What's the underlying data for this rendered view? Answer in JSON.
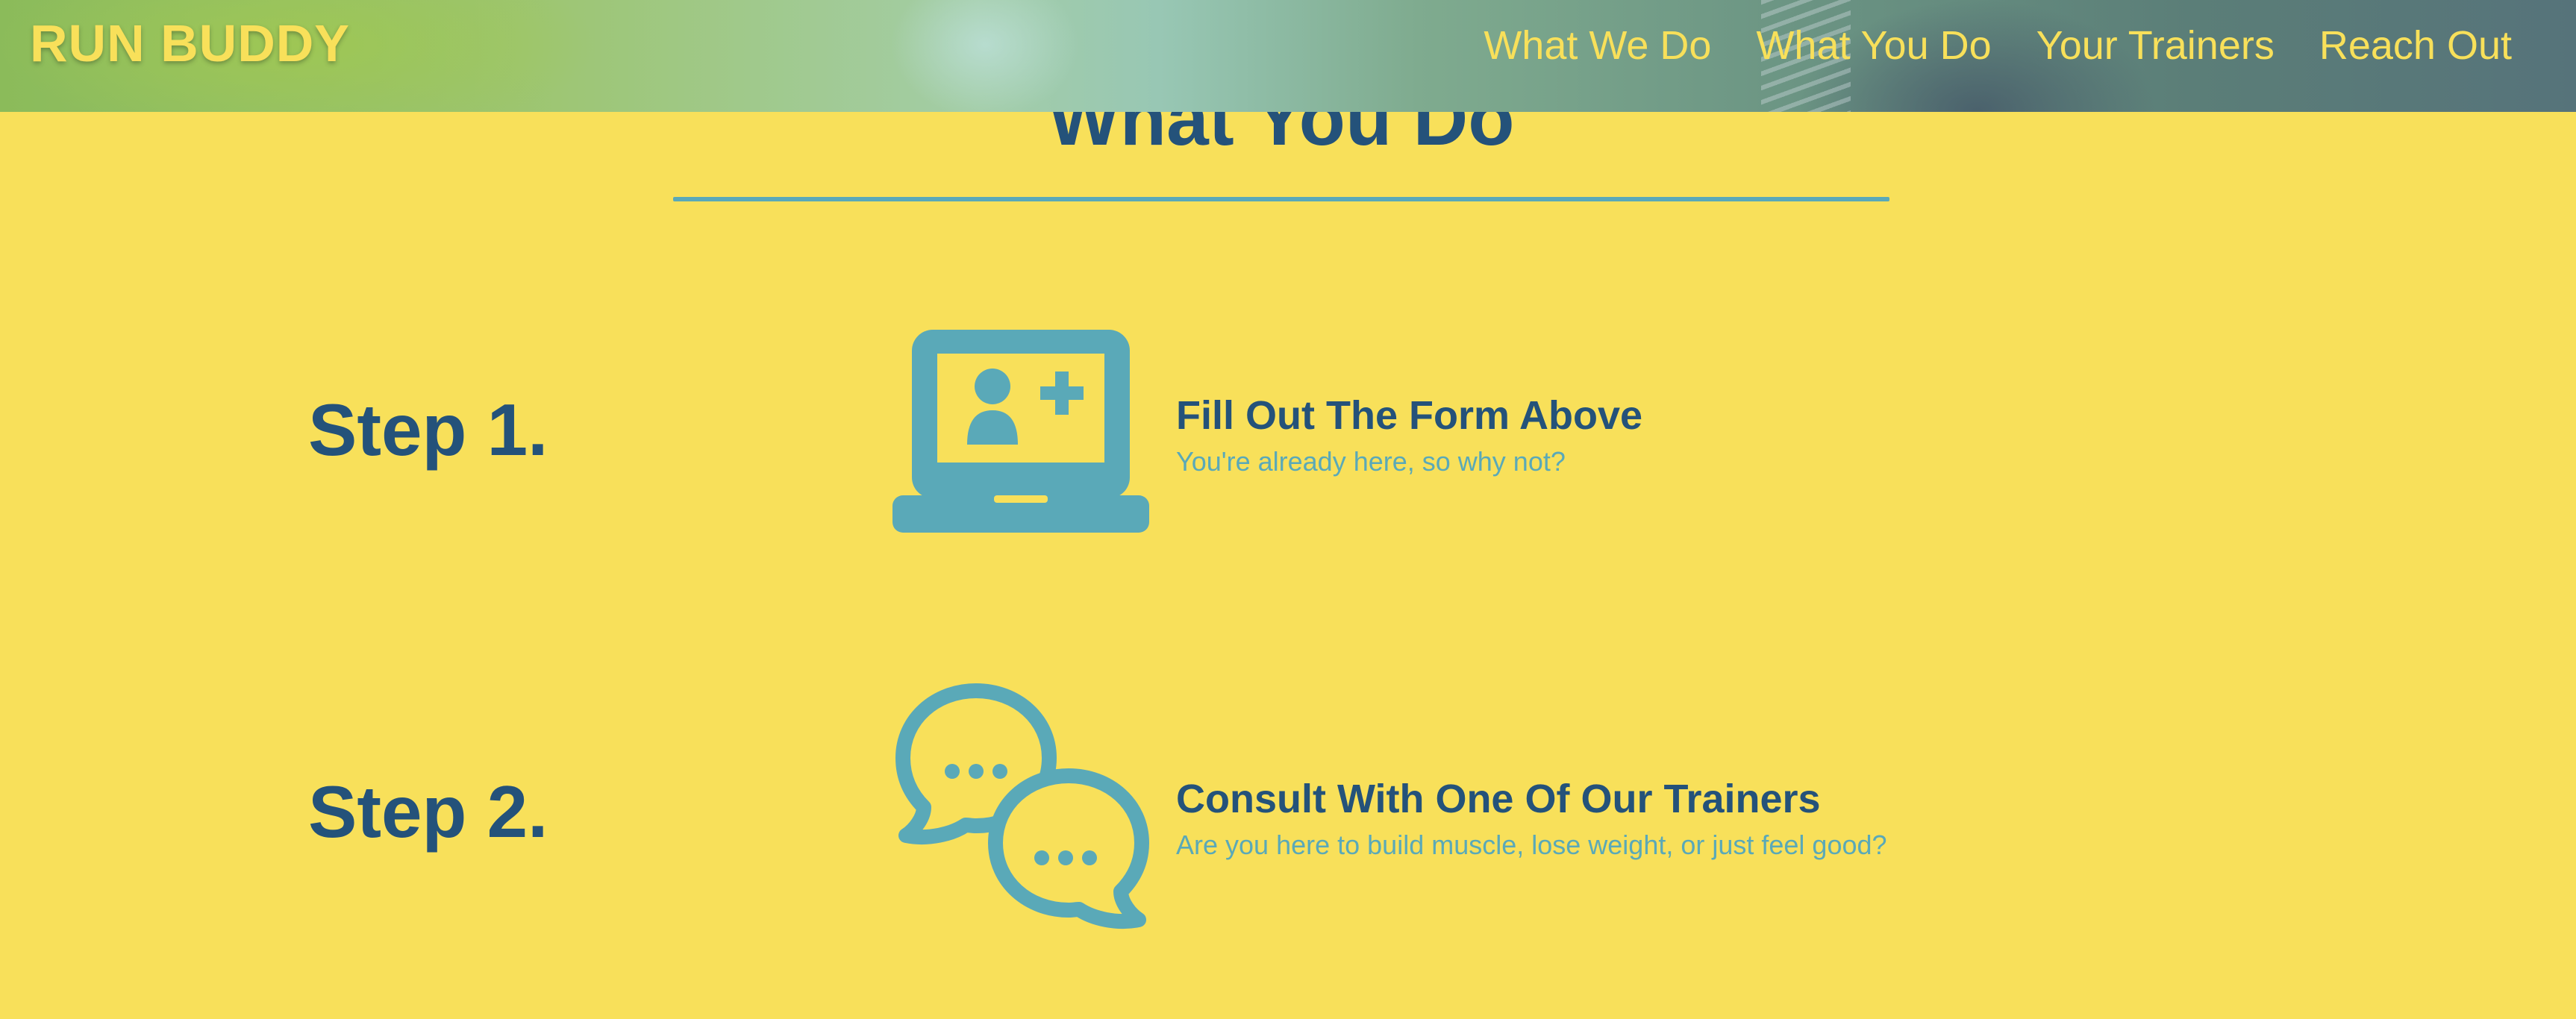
{
  "header": {
    "brand": "RUN BUDDY",
    "nav": [
      {
        "label": "What We Do"
      },
      {
        "label": "What You Do"
      },
      {
        "label": "Your Trainers"
      },
      {
        "label": "Reach Out"
      }
    ]
  },
  "section": {
    "title": "What You Do"
  },
  "steps": [
    {
      "label": "Step 1.",
      "icon": "laptop-add-user-icon",
      "heading": "Fill Out The Form Above",
      "description": "You're already here, so why not?"
    },
    {
      "label": "Step 2.",
      "icon": "chat-bubbles-icon",
      "heading": "Consult With One Of Our Trainers",
      "description": "Are you here to build muscle, lose weight, or just feel good?"
    }
  ],
  "colors": {
    "background": "#f8e05a",
    "primary": "#24527a",
    "accent": "#5aa9b8"
  }
}
